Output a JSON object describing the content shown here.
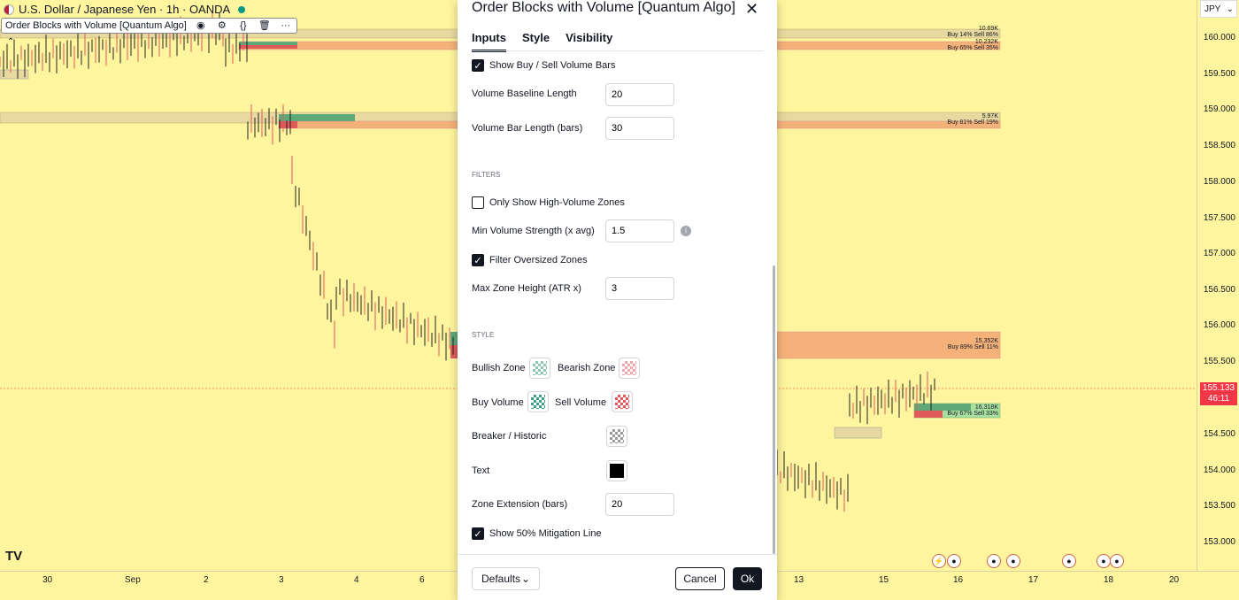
{
  "chart": {
    "symbol_title": "U.S. Dollar / Japanese Yen · 1h · OANDA",
    "indicator_name": "Order Blocks with Volume [Quantum Algo]",
    "currency_button": "JPY",
    "current_price": "155.133",
    "countdown": "46:11",
    "logo": "TV",
    "price_ticks": [
      "160.000",
      "159.500",
      "159.000",
      "158.500",
      "158.000",
      "157.500",
      "157.000",
      "156.500",
      "156.000",
      "155.500",
      "154.500",
      "154.000",
      "153.500",
      "153.000"
    ],
    "time_ticks": [
      "30",
      "Sep",
      "2",
      "3",
      "4",
      "6",
      "13",
      "15",
      "16",
      "17",
      "18",
      "20"
    ],
    "zones": [
      {
        "top_label": "10.69K",
        "bottom_label": "Buy 14%  Sell 86%"
      },
      {
        "top_label": "10.232K",
        "bottom_label": "Buy 65%  Sell 35%"
      },
      {
        "top_label": "5.97K",
        "bottom_label": "Buy 81%  Sell 19%"
      },
      {
        "top_label": "15.352K",
        "bottom_label": "Buy 89%  Sell 11%"
      },
      {
        "top_label": "16.318K",
        "bottom_label": "Buy 67%  Sell 33%"
      }
    ],
    "colors": {
      "background": "#fef59e",
      "bull": "#089981",
      "bear": "#f23645"
    }
  },
  "dialog": {
    "title": "Order Blocks with Volume [Quantum Algo]",
    "tabs": [
      {
        "label": "Inputs",
        "active": true
      },
      {
        "label": "Style",
        "active": false
      },
      {
        "label": "Visibility",
        "active": false
      }
    ],
    "show_volume_bars": {
      "label": "Show Buy / Sell Volume Bars",
      "checked": true
    },
    "volume_baseline": {
      "label": "Volume Baseline Length",
      "value": "20"
    },
    "volume_bar_length": {
      "label": "Volume Bar Length (bars)",
      "value": "30"
    },
    "filters_heading": "FILTERS",
    "only_high_volume": {
      "label": "Only Show High-Volume Zones",
      "checked": false
    },
    "min_volume_strength": {
      "label": "Min Volume Strength (x avg)",
      "value": "1.5"
    },
    "filter_oversized": {
      "label": "Filter Oversized Zones",
      "checked": true
    },
    "max_zone_height": {
      "label": "Max Zone Height (ATR x)",
      "value": "3"
    },
    "style_heading": "STYLE",
    "bullish_zone": "Bullish Zone",
    "bearish_zone": "Bearish Zone",
    "buy_volume": "Buy Volume",
    "sell_volume": "Sell Volume",
    "breaker_historic": "Breaker / Historic",
    "text_label": "Text",
    "zone_extension": {
      "label": "Zone Extension (bars)",
      "value": "20"
    },
    "show_mitigation": {
      "label": "Show 50% Mitigation Line",
      "checked": true
    },
    "defaults_button": "Defaults",
    "cancel_button": "Cancel",
    "ok_button": "Ok"
  }
}
